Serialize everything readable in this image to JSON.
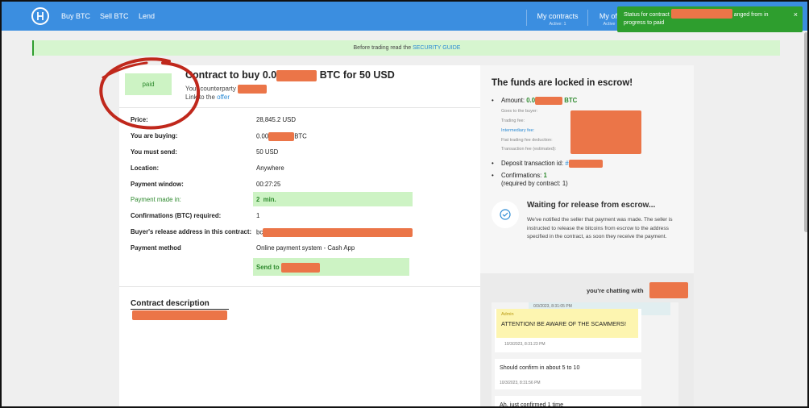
{
  "nav": {
    "links": [
      "Buy BTC",
      "Sell BTC",
      "Lend"
    ],
    "my_contracts": "My contracts",
    "my_contracts_sub": "Active: 1",
    "my_offers": "My off",
    "my_offers_sub": "Active"
  },
  "toast": {
    "line1_before": "Status for contract",
    "line1_after": "anged from in",
    "line2": "progress to paid",
    "close": "×"
  },
  "banner": {
    "text": "Before trading read the ",
    "link": "SECURITY GUIDE"
  },
  "contract": {
    "badge": "paid",
    "title_before": "Contract to buy 0.0",
    "title_after": " BTC for 50 USD",
    "counterparty": "Your counterparty",
    "link_prefix": "Link to the ",
    "link_text": "offer",
    "rows": [
      {
        "label": "Price:",
        "value": "28,845.2 USD"
      },
      {
        "label": "You are buying:",
        "value": "0.00",
        "value_suffix": "BTC"
      },
      {
        "label": "You must send:",
        "value": "50 USD"
      },
      {
        "label": "Location:",
        "value": "Anywhere"
      },
      {
        "label": "Payment window:",
        "value": "00:27:25"
      },
      {
        "label": "Payment made in:",
        "value": "2  min."
      },
      {
        "label": "Confirmations (BTC) required:",
        "value": "1"
      },
      {
        "label": "Buyer's release address in this contract:",
        "value": "bc"
      },
      {
        "label": "Payment method",
        "value": "Online payment system - Cash App"
      }
    ],
    "send_to": "Send to",
    "description_title": "Contract description"
  },
  "escrow": {
    "title": "The funds are locked in escrow!",
    "amount_label": "Amount: ",
    "amount_value": "0.0",
    "amount_unit": "BTC",
    "fees": [
      "Goes to the buyer:",
      "Trading fee:",
      "Intermediary fee:",
      "Fiat trading fee deduction:",
      "Transaction fee (estimated):"
    ],
    "deposit_label": "Deposit transaction id: ",
    "deposit_hash": "#",
    "confirmations_label": "Confirmations: ",
    "confirmations_value": "1",
    "required_note": "(required by contract: 1)",
    "wait_title": "Waiting for release from escrow...",
    "wait_text": "We've notified the seller that payment was made. The seller is instructed to release the bitcoins from escrow to the address specified in the contract, as soon they receive the payment."
  },
  "chat": {
    "header": "you're chatting with",
    "top_stub": "0/3/2023, 8:31:05 PM",
    "admin_name": "Admin",
    "admin_msg": "ATTENTION! BE AWARE OF THE SCAMMERS!",
    "admin_ts": "10/3/2023, 8:31:23 PM",
    "messages": [
      {
        "text": "Should confirm in about 5 to 10",
        "ts": "10/3/2023, 8:31:56 PM"
      },
      {
        "text": "Ah, just confirmed 1 time",
        "ts": ""
      }
    ]
  },
  "colors": {
    "nav": "#3b8ee0",
    "accent_green": "#2e8a2e",
    "badge_bg": "#cdf3c4",
    "redaction": "#eb7548",
    "annotation_circle": "#c0281c"
  }
}
